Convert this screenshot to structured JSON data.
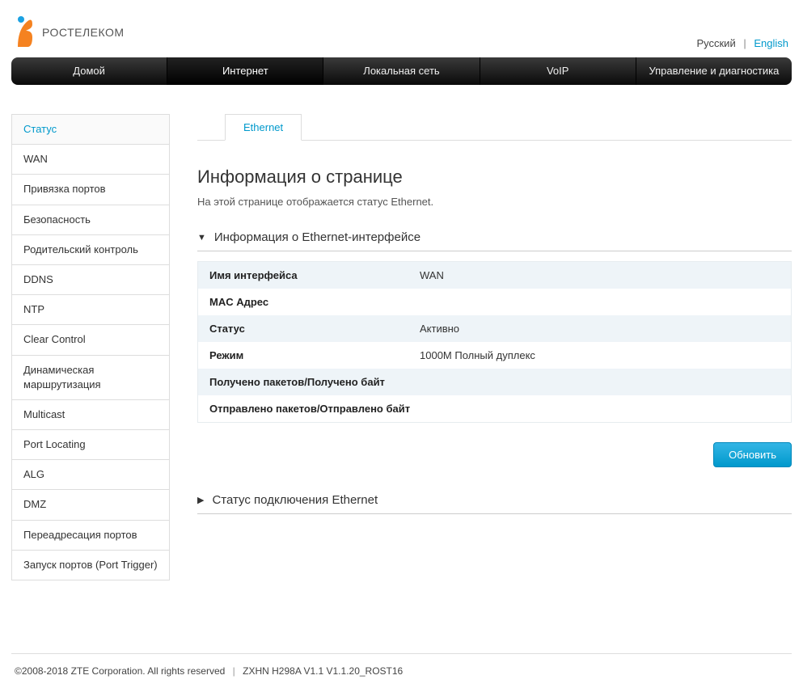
{
  "brand": {
    "name": "РОСТЕЛЕКОМ"
  },
  "lang": {
    "current": "Русский",
    "other": "English",
    "sep": "|"
  },
  "topnav": [
    {
      "label": "Домой"
    },
    {
      "label": "Интернет",
      "active": true
    },
    {
      "label": "Локальная сеть"
    },
    {
      "label": "VoIP"
    },
    {
      "label": "Управление и диагностика"
    }
  ],
  "sidebar": [
    {
      "label": "Статус",
      "selected": true
    },
    {
      "label": "WAN"
    },
    {
      "label": "Привязка портов"
    },
    {
      "label": "Безопасность"
    },
    {
      "label": "Родительский контроль"
    },
    {
      "label": "DDNS"
    },
    {
      "label": "NTP"
    },
    {
      "label": "Clear Control"
    },
    {
      "label": "Динамическая маршрутизация"
    },
    {
      "label": "Multicast"
    },
    {
      "label": "Port Locating"
    },
    {
      "label": "ALG"
    },
    {
      "label": "DMZ"
    },
    {
      "label": "Переадресация портов"
    },
    {
      "label": "Запуск портов (Port Trigger)"
    }
  ],
  "tabs": [
    {
      "label": "Ethernet",
      "active": true
    }
  ],
  "page": {
    "title": "Информация о странице",
    "desc": "На этой странице отображается статус Ethernet."
  },
  "sections": {
    "iface": {
      "title": "Информация о Ethernet-интерфейсе",
      "expanded": true,
      "rows": [
        {
          "label": "Имя интерфейса",
          "value": "WAN"
        },
        {
          "label": "MAC Адрес",
          "value": "",
          "blur": true
        },
        {
          "label": "Статус",
          "value": "Активно"
        },
        {
          "label": "Режим",
          "value": "1000M Полный дуплекс"
        },
        {
          "label": "Получено пакетов/Получено байт",
          "value": "",
          "blur": true,
          "wide": true
        },
        {
          "label": "Отправлено пакетов/Отправлено байт",
          "value": "",
          "blur": true,
          "wide": true
        }
      ]
    },
    "conn": {
      "title": "Статус подключения Ethernet",
      "expanded": false
    }
  },
  "buttons": {
    "refresh": "Обновить"
  },
  "footer": {
    "copyright": "©2008-2018 ZTE Corporation. All rights reserved",
    "model": "ZXHN H298A V1.1 V1.1.20_ROST16",
    "sep": "|"
  }
}
